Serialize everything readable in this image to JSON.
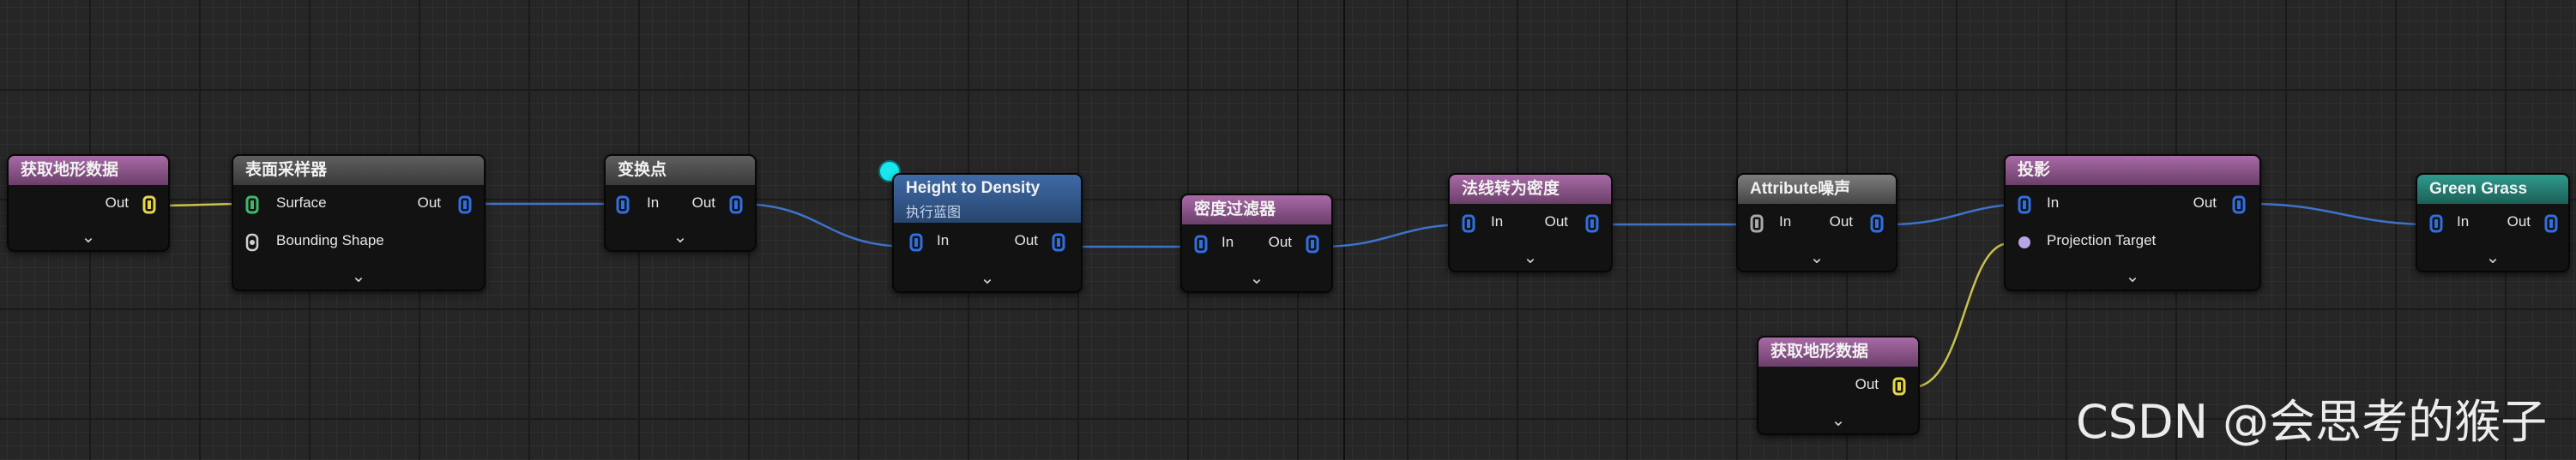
{
  "watermark": "CSDN @会思考的猴子",
  "colors": {
    "wire_blue": "#3f72c9",
    "wire_yellow": "#c9c24a",
    "pin_blue": "#2f6fe0",
    "pin_yellow": "#e6d84a",
    "pin_green": "#3fb86b",
    "exec_marker": "#19e6ee"
  },
  "nodes": {
    "get_landscape_1": {
      "title": "获取地形数据",
      "out": "Out"
    },
    "surface_sampler": {
      "title": "表面采样器",
      "in_surface": "Surface",
      "in_bounding": "Bounding Shape",
      "out": "Out"
    },
    "transform_points": {
      "title": "变换点",
      "in": "In",
      "out": "Out"
    },
    "height_to_density": {
      "title": "Height to Density",
      "subtitle": "执行蓝图",
      "in": "In",
      "out": "Out"
    },
    "density_filter": {
      "title": "密度过滤器",
      "in": "In",
      "out": "Out"
    },
    "normal_to_density": {
      "title": "法线转为密度",
      "in": "In",
      "out": "Out"
    },
    "attribute_noise": {
      "title": "Attribute噪声",
      "in": "In",
      "out": "Out"
    },
    "projection": {
      "title": "投影",
      "in": "In",
      "in_target": "Projection Target",
      "out": "Out"
    },
    "get_landscape_2": {
      "title": "获取地形数据",
      "out": "Out"
    },
    "green_grass": {
      "title": "Green Grass",
      "in": "In",
      "out": "Out"
    }
  },
  "expand_glyph": "⌄"
}
